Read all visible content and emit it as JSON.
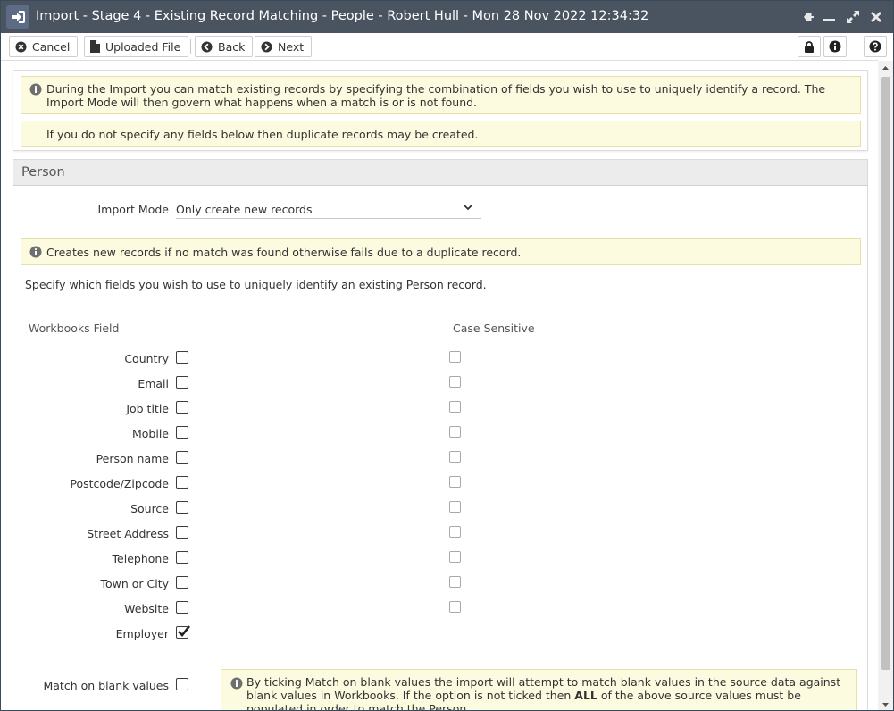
{
  "window": {
    "title": "Import - Stage 4 - Existing Record Matching - People - Robert Hull - Mon 28 Nov 2022 12:34:32"
  },
  "toolbar": {
    "cancel_label": "Cancel",
    "uploaded_file_label": "Uploaded File",
    "back_label": "Back",
    "next_label": "Next"
  },
  "notices": {
    "intro": "During the Import you can match existing records by specifying the combination of fields you wish to use to uniquely identify a record. The Import Mode will then govern what happens when a match is or is not found.",
    "duplicate_warning": "If you do not specify any fields below then duplicate records may be created."
  },
  "panel": {
    "title": "Person",
    "import_mode_label": "Import Mode",
    "import_mode_value": "Only create new records",
    "mode_description": "Creates new records if no match was found otherwise fails due to a duplicate record.",
    "instructions": "Specify which fields you wish to use to uniquely identify an existing Person record.",
    "col_field": "Workbooks Field",
    "col_case": "Case Sensitive",
    "fields": [
      {
        "label": "Country",
        "checked": false,
        "case_sensitive": false
      },
      {
        "label": "Email",
        "checked": false,
        "case_sensitive": false
      },
      {
        "label": "Job title",
        "checked": false,
        "case_sensitive": false
      },
      {
        "label": "Mobile",
        "checked": false,
        "case_sensitive": false
      },
      {
        "label": "Person name",
        "checked": false,
        "case_sensitive": false
      },
      {
        "label": "Postcode/Zipcode",
        "checked": false,
        "case_sensitive": false
      },
      {
        "label": "Source",
        "checked": false,
        "case_sensitive": false
      },
      {
        "label": "Street Address",
        "checked": false,
        "case_sensitive": false
      },
      {
        "label": "Telephone",
        "checked": false,
        "case_sensitive": false
      },
      {
        "label": "Town or City",
        "checked": false,
        "case_sensitive": false
      },
      {
        "label": "Website",
        "checked": false,
        "case_sensitive": false
      },
      {
        "label": "Employer",
        "checked": true
      }
    ],
    "match_blank_label": "Match on blank values",
    "match_blank_checked": false,
    "blank_note_part1": "By ticking Match on blank values the import will attempt to match blank values in the source data against blank values in Workbooks. If the option is not ticked then ",
    "blank_note_bold": "ALL",
    "blank_note_part2": " of the above source values must be populated in order to match the Person."
  },
  "colors": {
    "titlebar": "#4a5360",
    "notice_bg": "#fcfbdf",
    "notice_border": "#e3e0a9"
  },
  "icons": [
    "sign-in-icon",
    "pin-icon",
    "minimize-icon",
    "maximize-icon",
    "close-icon",
    "times-circle-icon",
    "file-icon",
    "arrow-circle-left-icon",
    "arrow-circle-right-icon",
    "lock-icon",
    "info-circle-icon",
    "question-circle-icon",
    "chevron-down-icon",
    "check-icon"
  ]
}
